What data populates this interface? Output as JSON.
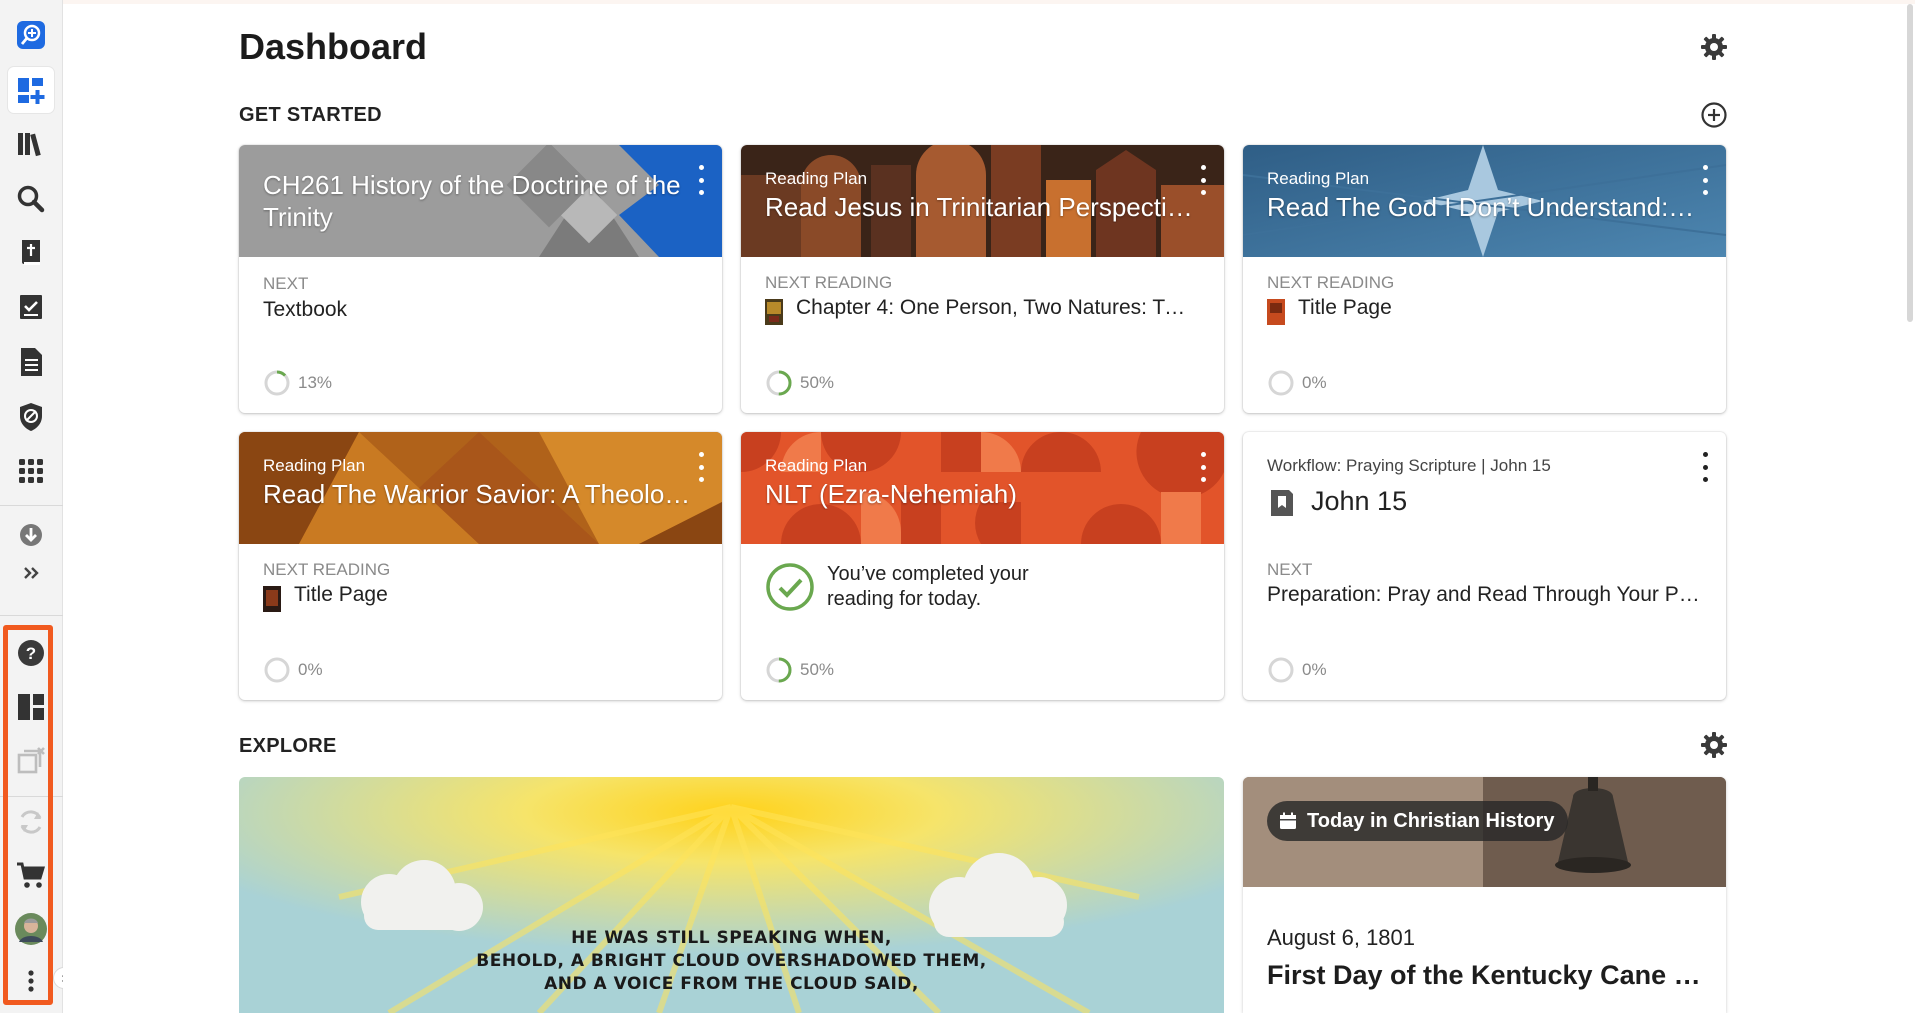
{
  "page": {
    "title": "Dashboard"
  },
  "sections": {
    "get_started": "GET STARTED",
    "explore": "EXPLORE"
  },
  "cards": [
    {
      "subtitle": "",
      "title": "CH261 History of the Doctrine of the Trinity",
      "label": "NEXT",
      "next": "Textbook",
      "progress_text": "13%",
      "progress": 0.13
    },
    {
      "subtitle": "Reading Plan",
      "title": "Read Jesus in Trinitarian Perspecti…",
      "label": "NEXT READING",
      "next": "Chapter 4: One Person, Two Natures: Tw…",
      "progress_text": "50%",
      "progress": 0.5
    },
    {
      "subtitle": "Reading Plan",
      "title": "Read The God I Don’t Understand:…",
      "label": "NEXT READING",
      "next": "Title Page",
      "progress_text": "0%",
      "progress": 0
    },
    {
      "subtitle": "Reading Plan",
      "title": "Read The Warrior Savior: A Theolo…",
      "label": "NEXT READING",
      "next": "Title Page",
      "progress_text": "0%",
      "progress": 0
    },
    {
      "subtitle": "Reading Plan",
      "title": "NLT (Ezra-Nehemiah)",
      "completed_text": "You’ve completed your reading for today.",
      "progress_text": "50%",
      "progress": 0.5
    },
    {
      "subtitle": "Workflow: Praying Scripture | John 15",
      "title": "John 15",
      "label": "NEXT",
      "next": "Preparation: Pray and Read Through Your Pas…",
      "progress_text": "0%",
      "progress": 0
    }
  ],
  "explore": {
    "verse_lines": [
      "HE WAS STILL SPEAKING WHEN,",
      "BEHOLD, A BRIGHT CLOUD OVERSHADOWED THEM,",
      "AND A VOICE FROM THE CLOUD SAID,"
    ],
    "history": {
      "badge": "Today in Christian History",
      "date": "August 6, 1801",
      "title": "First Day of the Kentucky Cane Rid…"
    }
  },
  "sidebar_icons": [
    "search-plus-icon",
    "dashboard-add-icon",
    "library-icon",
    "search-icon",
    "bible-icon",
    "tasks-icon",
    "document-icon",
    "shield-icon",
    "apps-grid-icon",
    "download-icon",
    "expand-double-chevron-icon",
    "help-icon",
    "layout-icon",
    "close-windows-icon",
    "sync-icon",
    "cart-icon",
    "avatar",
    "more-vertical-icon"
  ],
  "colors": {
    "accent": "#1e6ae1",
    "highlight": "#f15a1f",
    "progress": "#6aa84f"
  }
}
